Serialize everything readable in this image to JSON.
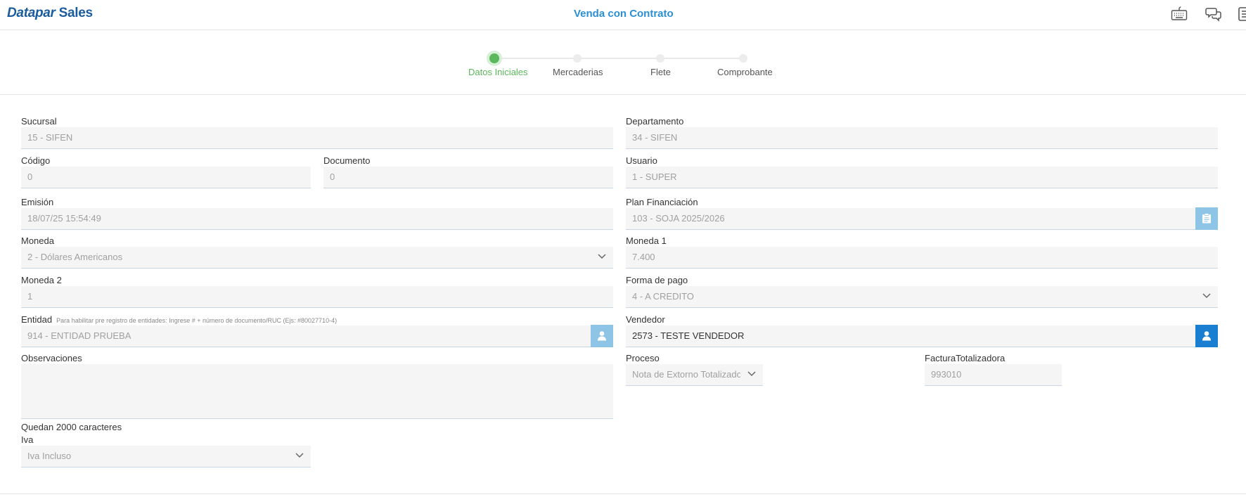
{
  "header": {
    "brand_main": "Datapar",
    "brand_sub": "Sales",
    "title": "Venda con Contrato",
    "icons": [
      "keyboard-icon",
      "chat-icon",
      "document-icon"
    ]
  },
  "stepper": {
    "steps": [
      {
        "label": "Datos Iniciales",
        "active": true
      },
      {
        "label": "Mercaderias",
        "active": false
      },
      {
        "label": "Flete",
        "active": false
      },
      {
        "label": "Comprobante",
        "active": false
      }
    ],
    "active_color": "#5cb85c"
  },
  "form": {
    "sucursal": {
      "label": "Sucursal",
      "value": "15 - SIFEN"
    },
    "departamento": {
      "label": "Departamento",
      "value": "34 - SIFEN"
    },
    "codigo": {
      "label": "Código",
      "value": "0"
    },
    "documento": {
      "label": "Documento",
      "value": "0"
    },
    "usuario": {
      "label": "Usuario",
      "value": "1 - SUPER"
    },
    "emision": {
      "label": "Emisión",
      "value": "18/07/25 15:54:49"
    },
    "plan": {
      "label": "Plan Financiación",
      "value": "103 - SOJA 2025/2026"
    },
    "moneda": {
      "label": "Moneda",
      "value": "2 - Dólares Americanos"
    },
    "moneda1": {
      "label": "Moneda 1",
      "value": "7.400"
    },
    "moneda2": {
      "label": "Moneda 2",
      "value": "1"
    },
    "forma_pago": {
      "label": "Forma de pago",
      "value": "4 - A CREDITO"
    },
    "entidad": {
      "label": "Entidad",
      "hint": "Para habilitar pre registro de entidades: Ingrese # + número de documento/RUC (Ejs: #80027710-4)",
      "value": "914 - ENTIDAD PRUEBA"
    },
    "vendedor": {
      "label": "Vendedor",
      "value": "2573 - TESTE VENDEDOR"
    },
    "observaciones": {
      "label": "Observaciones",
      "value": "",
      "remaining": "Quedan 2000 caracteres"
    },
    "proceso": {
      "label": "Proceso",
      "value": "Nota de Extorno Totalizadora"
    },
    "factura": {
      "label": "FacturaTotalizadora",
      "value": "993010"
    },
    "iva": {
      "label": "Iva",
      "value": "Iva Incluso"
    }
  },
  "colors": {
    "brand": "#1a5c9e",
    "title": "#2a8fd4",
    "button_light": "#8ec4e6",
    "button_strong": "#1a7fd0"
  }
}
